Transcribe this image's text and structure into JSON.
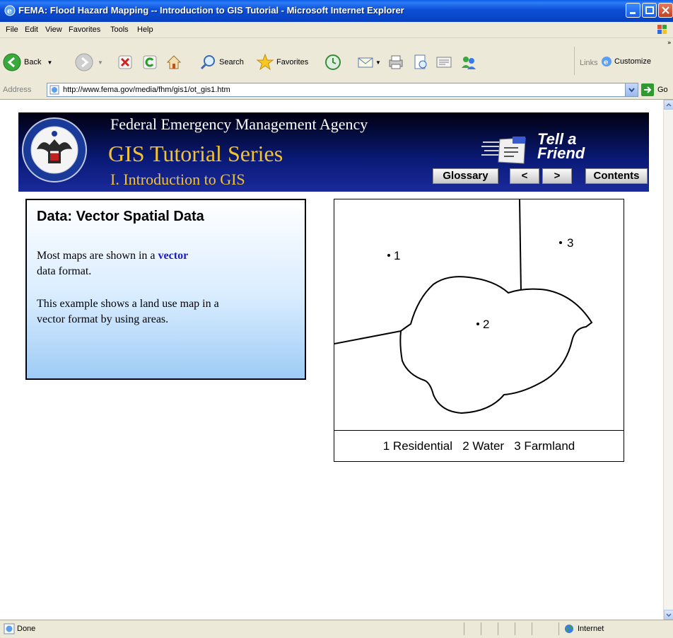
{
  "window": {
    "title": "FEMA: Flood Hazard Mapping -- Introduction to GIS Tutorial - Microsoft Internet Explorer"
  },
  "menu": [
    "File",
    "Edit",
    "View",
    "Favorites",
    "Tools",
    "Help"
  ],
  "toolbar": {
    "back": "Back",
    "search": "Search",
    "favorites": "Favorites",
    "links": "Links",
    "customize": "Customize"
  },
  "address": {
    "label": "Address",
    "url": "http://www.fema.gov/media/fhm/gis1/ot_gis1.htm",
    "go": "Go"
  },
  "status": {
    "text": "Done",
    "zone": "Internet"
  },
  "banner": {
    "agency": "Federal Emergency Management Agency",
    "series": "GIS Tutorial Series",
    "chapter": "I. Introduction to GIS",
    "tell_a_friend_line1": "Tell a",
    "tell_a_friend_line2": "Friend",
    "buttons": {
      "glossary": "Glossary",
      "prev": "<",
      "next": ">",
      "contents": "Contents"
    }
  },
  "lesson": {
    "heading": "Data: Vector Spatial Data",
    "p1_before": "Most maps are shown in a",
    "p1_keyword": "vector",
    "p1_after": "data format.",
    "p2": "This example shows a land use map in a vector format by using areas."
  },
  "map": {
    "labels": [
      "1",
      "2",
      "3"
    ],
    "legend": "1 Residential   2 Water   3 Farmland"
  }
}
